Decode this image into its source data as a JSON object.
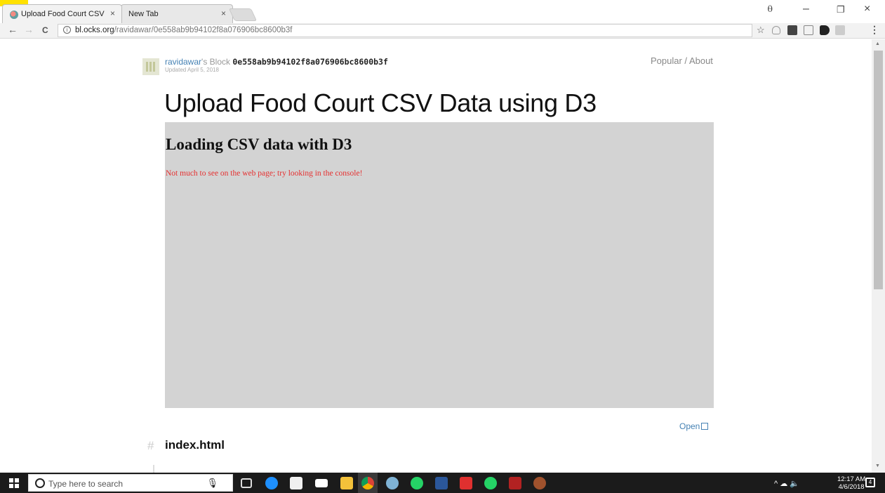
{
  "browser": {
    "tabs": [
      {
        "title": "Upload Food Court CSV",
        "close": "×"
      },
      {
        "title": "New Tab",
        "close": "×"
      }
    ],
    "window_controls": {
      "minimize": "–",
      "restore": "❐",
      "close": "×",
      "profile": "⍬"
    },
    "nav": {
      "back": "←",
      "forward": "→",
      "reload": "C"
    },
    "url_host": "bl.ocks.org",
    "url_path": "/ravidawar/0e558ab9b94102f8a076906bc8600b3f",
    "menu": "⋮",
    "bookmark_star": "☆",
    "extension_icons": [
      "extension-icon-1",
      "extension-icon-2",
      "cast-icon",
      "extension-icon-4",
      "extension-icon-5"
    ]
  },
  "page": {
    "user": "ravidawar",
    "block_suffix": "'s Block",
    "block_id": "0e558ab9b94102f8a076906bc8600b3f",
    "updated": "Updated April 5, 2018",
    "nav_popular": "Popular",
    "nav_separator": " / ",
    "nav_about": "About",
    "title": "Upload Food Court CSV Data using D3",
    "frame_heading": "Loading CSV data with D3",
    "frame_message": "Not much to see on the web page; try looking in the console!",
    "open_link": "Open",
    "hash": "#",
    "file_name": "index.html"
  },
  "taskbar": {
    "search_placeholder": "Type here to search",
    "time": "12:17 AM",
    "date": "4/6/2018",
    "notification_count": "4",
    "tray_icons": "^ ☁ 🔈",
    "pinned_icons": [
      "task-view-icon",
      "edge-icon",
      "store-icon",
      "mail-icon",
      "file-explorer-icon",
      "chrome-icon",
      "paint-icon",
      "whatsapp-icon",
      "word-icon",
      "bluestacks-icon",
      "whatsapp-icon-2",
      "snipping-icon",
      "settings-icon"
    ]
  }
}
